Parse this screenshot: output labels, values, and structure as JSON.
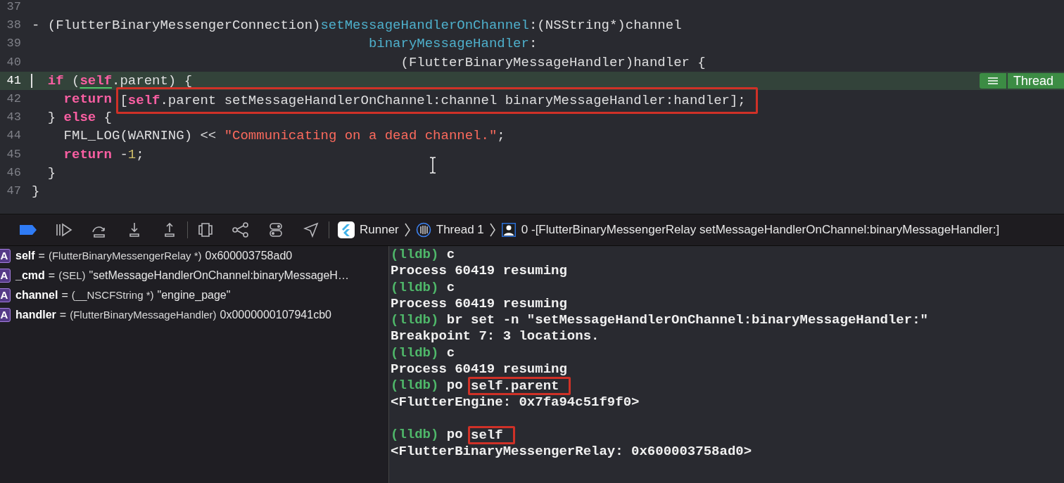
{
  "editor": {
    "lines": [
      {
        "number": "37",
        "current": false
      },
      {
        "number": "38",
        "current": false,
        "tokens": [
          {
            "kind": "plain",
            "text": "- (FlutterBinaryMessengerConnection)"
          },
          {
            "kind": "method",
            "text": "setMessageHandlerOnChannel"
          },
          {
            "kind": "plain",
            "text": ":(NSString*)channel"
          }
        ]
      },
      {
        "number": "39",
        "current": false,
        "tokens": [
          {
            "kind": "method",
            "text": "                                          binaryMessageHandler"
          },
          {
            "kind": "plain",
            "text": ":"
          }
        ]
      },
      {
        "number": "40",
        "current": false,
        "tokens": [
          {
            "kind": "plain",
            "text": "                                              (FlutterBinaryMessageHandler)handler {"
          }
        ]
      },
      {
        "number": "41",
        "current": true,
        "tokens": [
          {
            "kind": "keyword",
            "text": "  if"
          },
          {
            "kind": "plain",
            "text": " ("
          },
          {
            "kind": "link",
            "text": "self"
          },
          {
            "kind": "plain",
            "text": ".parent) {"
          }
        ]
      },
      {
        "number": "42",
        "current": false,
        "tokens": [
          {
            "kind": "keyword",
            "text": "    return "
          },
          {
            "kind": "boxed",
            "tokens": [
              {
                "kind": "plain",
                "text": "["
              },
              {
                "kind": "keyword",
                "text": "self"
              },
              {
                "kind": "plain",
                "text": ".parent setMessageHandlerOnChannel:channel binaryMessageHandler:handler];"
              }
            ]
          }
        ]
      },
      {
        "number": "43",
        "current": false,
        "tokens": [
          {
            "kind": "plain",
            "text": "  } "
          },
          {
            "kind": "keyword",
            "text": "else"
          },
          {
            "kind": "plain",
            "text": " {"
          }
        ]
      },
      {
        "number": "44",
        "current": false,
        "tokens": [
          {
            "kind": "plain",
            "text": "    FML_LOG(WARNING) << "
          },
          {
            "kind": "string",
            "text": "\"Communicating on a dead channel.\""
          },
          {
            "kind": "plain",
            "text": ";"
          }
        ]
      },
      {
        "number": "45",
        "current": false,
        "tokens": [
          {
            "kind": "keyword",
            "text": "    return"
          },
          {
            "kind": "plain",
            "text": " -"
          },
          {
            "kind": "number",
            "text": "1"
          },
          {
            "kind": "plain",
            "text": ";"
          }
        ]
      },
      {
        "number": "46",
        "current": false,
        "tokens": [
          {
            "kind": "plain",
            "text": "  }"
          }
        ]
      },
      {
        "number": "47",
        "current": false,
        "tokens": [
          {
            "kind": "plain",
            "text": "}"
          }
        ]
      }
    ],
    "thread_badge": {
      "label": "Thread"
    }
  },
  "debug_bar": {
    "breakpoints_active": true,
    "breadcrumbs": [
      {
        "kind": "app",
        "label": "Runner"
      },
      {
        "kind": "thread",
        "label": "Thread 1"
      },
      {
        "kind": "frame",
        "label": "0 -[FlutterBinaryMessengerRelay setMessageHandlerOnChannel:binaryMessageHandler:]"
      }
    ]
  },
  "variables": [
    {
      "badge": "A",
      "name": "self",
      "equals": "=",
      "type": "(FlutterBinaryMessengerRelay *)",
      "value": "0x600003758ad0"
    },
    {
      "badge": "A",
      "name": "_cmd",
      "equals": "=",
      "type": "(SEL)",
      "value": "\"setMessageHandlerOnChannel:binaryMessageH…"
    },
    {
      "badge": "A",
      "name": "channel",
      "equals": "=",
      "type": "(__NSCFString *)",
      "value": "\"engine_page\""
    },
    {
      "badge": "A",
      "name": "handler",
      "equals": "=",
      "type": "(FlutterBinaryMessageHandler)",
      "value": "0x0000000107941cb0"
    }
  ],
  "console": [
    {
      "lines": [
        {
          "tokens": [
            {
              "kind": "prompt",
              "text": "(lldb)"
            },
            {
              "kind": "command",
              "text": " c"
            }
          ]
        },
        {
          "tokens": [
            {
              "kind": "output",
              "text": "Process 60419 resuming"
            }
          ]
        },
        {
          "tokens": [
            {
              "kind": "prompt",
              "text": "(lldb)"
            },
            {
              "kind": "command",
              "text": " c"
            }
          ]
        },
        {
          "tokens": [
            {
              "kind": "output",
              "text": "Process 60419 resuming"
            }
          ]
        },
        {
          "tokens": [
            {
              "kind": "prompt",
              "text": "(lldb)"
            },
            {
              "kind": "command",
              "text": " br set -n \"setMessageHandlerOnChannel:binaryMessageHandler:\""
            }
          ]
        },
        {
          "tokens": [
            {
              "kind": "output",
              "text": "Breakpoint 7: 3 locations."
            }
          ]
        },
        {
          "tokens": [
            {
              "kind": "prompt",
              "text": "(lldb)"
            },
            {
              "kind": "command",
              "text": " c"
            }
          ]
        },
        {
          "tokens": [
            {
              "kind": "output",
              "text": "Process 60419 resuming"
            }
          ]
        },
        {
          "tokens": [
            {
              "kind": "prompt",
              "text": "(lldb)"
            },
            {
              "kind": "command",
              "text": " po "
            },
            {
              "kind": "boxed",
              "tokens": [
                {
                  "kind": "command",
                  "text": "self.parent"
                }
              ]
            }
          ]
        },
        {
          "tokens": [
            {
              "kind": "output",
              "text": "<FlutterEngine: 0x7fa94c51f9f0>"
            }
          ]
        }
      ]
    },
    {
      "lines": [
        {
          "tokens": [
            {
              "kind": "prompt",
              "text": "(lldb)"
            },
            {
              "kind": "command",
              "text": " po "
            },
            {
              "kind": "boxed",
              "tokens": [
                {
                  "kind": "command",
                  "text": "self"
                }
              ]
            }
          ]
        },
        {
          "tokens": [
            {
              "kind": "output",
              "text": "<FlutterBinaryMessengerRelay: 0x600003758ad0>"
            }
          ]
        }
      ]
    }
  ]
}
